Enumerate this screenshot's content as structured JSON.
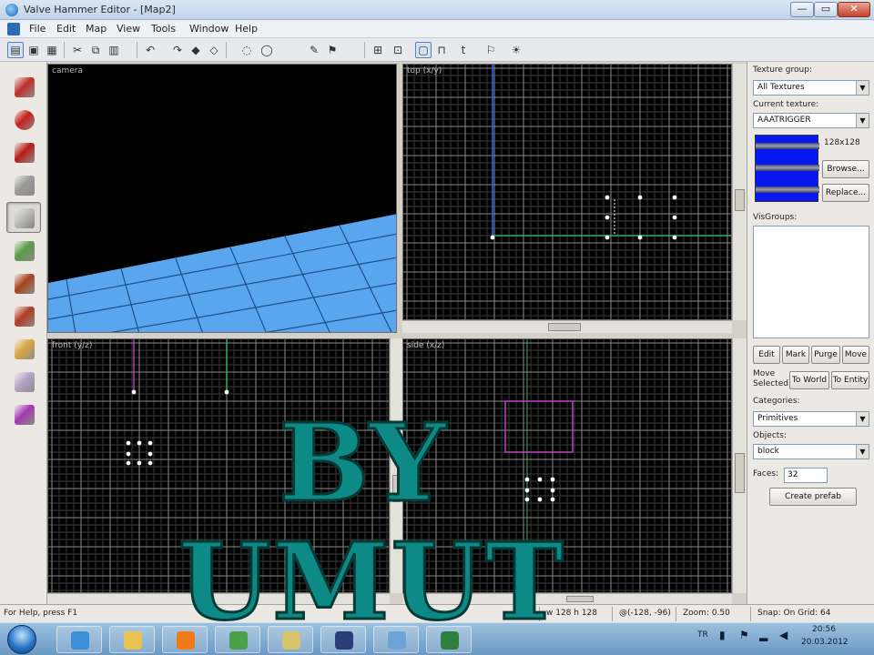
{
  "window": {
    "title": "Valve Hammer Editor - [Map2]",
    "min_label": "—",
    "max_label": "▭",
    "close_label": "✕"
  },
  "menu": [
    "File",
    "Edit",
    "Map",
    "View",
    "Tools",
    "Window",
    "Help"
  ],
  "toolbar_icons": [
    "new-icon",
    "open-icon",
    "save-icon",
    "cut-icon",
    "copy-icon",
    "paste-icon",
    "undo-icon",
    "redo-icon",
    "carve-icon",
    "group-icon",
    "ungroup-icon",
    "hide-icon",
    "texture-lock-icon",
    "run-map-icon",
    "grid-icon",
    "snap-icon",
    "cordon-icon",
    "entity-report-icon"
  ],
  "tools": [
    {
      "name": "selection-tool",
      "icon": "pointer-icon",
      "color": "#c0302a"
    },
    {
      "name": "magnify-tool",
      "icon": "magnify-icon",
      "color": "#c8201a"
    },
    {
      "name": "camera-tool",
      "icon": "camera-icon",
      "color": "#b81c16"
    },
    {
      "name": "entity-tool",
      "icon": "entity-icon",
      "color": "#9a9a9a"
    },
    {
      "name": "block-tool",
      "icon": "block-icon",
      "color": "#bdbdbd",
      "selected": true
    },
    {
      "name": "texture-app-tool",
      "icon": "texture-app-icon",
      "color": "#5a9a46"
    },
    {
      "name": "apply-texture-tool",
      "icon": "apply-texture-icon",
      "color": "#a8421e"
    },
    {
      "name": "decal-tool",
      "icon": "decal-icon",
      "color": "#b03a22"
    },
    {
      "name": "clip-tool",
      "icon": "clip-icon",
      "color": "#d7a640"
    },
    {
      "name": "vertex-tool",
      "icon": "vertex-icon",
      "color": "#b7a3c6"
    },
    {
      "name": "path-tool",
      "icon": "path-icon",
      "color": "#a23ab0"
    }
  ],
  "viewports": {
    "camera": {
      "label": "camera"
    },
    "top": {
      "label": "top (x/y)"
    },
    "front": {
      "label": "front (y/z)"
    },
    "side": {
      "label": "side (x/z)"
    }
  },
  "rpanel": {
    "texture_group_label": "Texture group:",
    "texture_group_value": "All Textures",
    "current_texture_label": "Current texture:",
    "current_texture_value": "AAATRIGGER",
    "texture_size": "128x128",
    "browse_label": "Browse...",
    "replace_label": "Replace...",
    "vis_groups_label": "VisGroups:",
    "btn_edit": "Edit",
    "btn_mark": "Mark",
    "btn_purge": "Purge",
    "btn_move": "Move",
    "move_selected_label": "Move Selected:",
    "btn_to_world": "To World",
    "btn_to_entity": "To Entity",
    "categories_label": "Categories:",
    "categories_value": "Primitives",
    "objects_label": "Objects:",
    "objects_value": "block",
    "faces_label": "Faces:",
    "faces_value": "32",
    "create_prefab_label": "Create prefab"
  },
  "status": {
    "help": "For Help, press F1",
    "size": "w 128 h 128",
    "coords": "@(-128, -96)",
    "zoom": "Zoom: 0.50",
    "snap": "Snap: On  Grid: 64"
  },
  "taskbar": {
    "apps": [
      {
        "icon": "ie-icon",
        "color": "#3c8fd6"
      },
      {
        "icon": "folder-icon",
        "color": "#e9c34f"
      },
      {
        "icon": "media-player-icon",
        "color": "#f07a18"
      },
      {
        "icon": "chrome-icon",
        "color": "#4aa04a"
      },
      {
        "icon": "folder-2-icon",
        "color": "#d6c46a"
      },
      {
        "icon": "steam-icon",
        "color": "#2b3d77"
      },
      {
        "icon": "hammer-icon",
        "color": "#6fa3d6"
      },
      {
        "icon": "app-icon",
        "color": "#2f7f3f"
      }
    ],
    "tray_lang": "TR",
    "clock_time": "20:56",
    "clock_date": "20.03.2012"
  },
  "watermark": {
    "line1": "BY",
    "line2": "UMUT"
  }
}
